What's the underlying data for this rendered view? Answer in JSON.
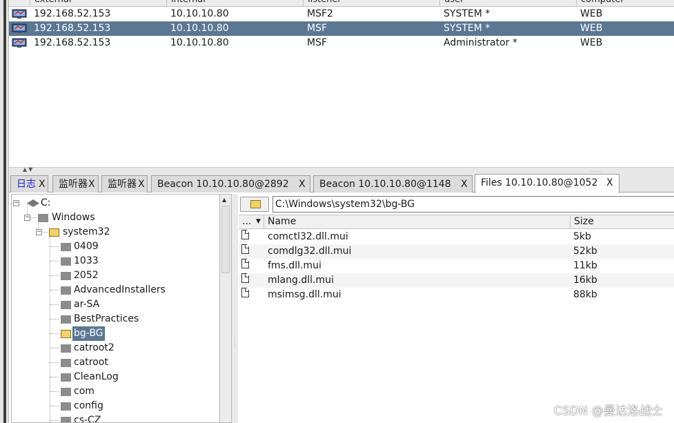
{
  "beacons": {
    "columns": [
      "external",
      "internal",
      "listener",
      "user",
      "computer"
    ],
    "rows": [
      {
        "external": "192.168.52.153",
        "internal": "10.10.10.80",
        "listener": "MSF2",
        "user": "SYSTEM *",
        "computer": "WEB"
      },
      {
        "external": "192.168.52.153",
        "internal": "10.10.10.80",
        "listener": "MSF",
        "user": "SYSTEM *",
        "computer": "WEB"
      },
      {
        "external": "192.168.52.153",
        "internal": "10.10.10.80",
        "listener": "MSF",
        "user": "Administrator *",
        "computer": "WEB"
      }
    ],
    "selected_row": 1
  },
  "tabs": [
    {
      "label": "日志",
      "close": "X"
    },
    {
      "label": "监听器",
      "close": "X"
    },
    {
      "label": "监听器",
      "close": "X"
    },
    {
      "label": "Beacon 10.10.10.80@2892",
      "close": "X"
    },
    {
      "label": "Beacon 10.10.10.80@1148",
      "close": "X"
    },
    {
      "label": "Files 10.10.10.80@1052",
      "close": "X"
    }
  ],
  "tree": {
    "drive": "C:",
    "windows": "Windows",
    "system32": "system32",
    "folders": [
      "0409",
      "1033",
      "2052",
      "AdvancedInstallers",
      "ar-SA",
      "BestPractices",
      "bg-BG",
      "catroot2",
      "catroot",
      "CleanLog",
      "com",
      "config",
      "cs-CZ"
    ],
    "selected": "bg-BG"
  },
  "path": "C:\\Windows\\system32\\bg-BG",
  "files": {
    "col_menu": "...",
    "col_name": "Name",
    "col_size": "Size",
    "rows": [
      {
        "name": "comctl32.dll.mui",
        "size": "5kb"
      },
      {
        "name": "comdlg32.dll.mui",
        "size": "52kb"
      },
      {
        "name": "fms.dll.mui",
        "size": "11kb"
      },
      {
        "name": "mlang.dll.mui",
        "size": "16kb"
      },
      {
        "name": "msimsg.dll.mui",
        "size": "88kb"
      }
    ]
  },
  "watermark": "CSDN @曼达洛战士"
}
